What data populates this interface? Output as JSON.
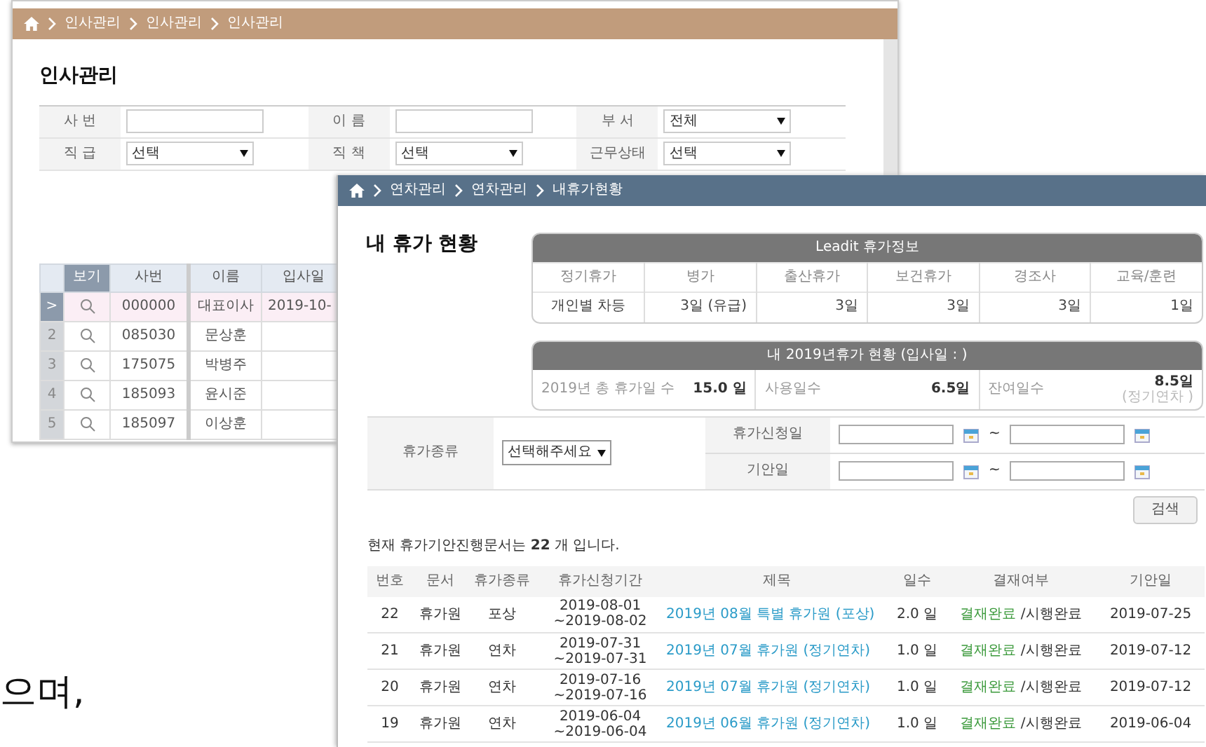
{
  "document_text": "으며,",
  "personnel_window": {
    "breadcrumb": [
      "인사관리",
      "인사관리",
      "인사관리"
    ],
    "title": "인사관리",
    "search_fields": [
      {
        "label": "사 번",
        "kind": "text"
      },
      {
        "label": "이 름",
        "kind": "text"
      },
      {
        "label": "부 서",
        "kind": "select",
        "value": "전체"
      },
      {
        "label": "직 급",
        "kind": "select",
        "value": "선택"
      },
      {
        "label": "직 책",
        "kind": "select",
        "value": "선택"
      },
      {
        "label": "근무상태",
        "kind": "select",
        "value": "선택"
      }
    ],
    "grid": {
      "columns": [
        "보기",
        "사번",
        "이름",
        "입사일"
      ],
      "rows": [
        {
          "marker": ">",
          "id": "000000",
          "name": "대표이사",
          "hire_date": "2019-10-",
          "selected": true
        },
        {
          "marker": "2",
          "id": "085030",
          "name": "문상훈",
          "hire_date": "",
          "selected": false
        },
        {
          "marker": "3",
          "id": "175075",
          "name": "박병주",
          "hire_date": "",
          "selected": false
        },
        {
          "marker": "4",
          "id": "185093",
          "name": "윤시준",
          "hire_date": "",
          "selected": false
        },
        {
          "marker": "5",
          "id": "185097",
          "name": "이상훈",
          "hire_date": "",
          "selected": false
        }
      ]
    }
  },
  "leave_window": {
    "breadcrumb": [
      "연차관리",
      "연차관리",
      "내휴가현황"
    ],
    "title": "내 휴가 현황",
    "leave_info": {
      "title": "Leadit 휴가정보",
      "columns": [
        "정기휴가",
        "병가",
        "출산휴가",
        "보건휴가",
        "경조사",
        "교육/훈련"
      ],
      "values": [
        "개인별 차등",
        "3일 (유급)",
        "3일",
        "3일",
        "3일",
        "1일"
      ]
    },
    "summary": {
      "title": "내 2019년휴가 현황 (입사일 : )",
      "items": [
        {
          "label": "2019년 총 휴가일 수",
          "value": "15.0 일"
        },
        {
          "label": "사용일수",
          "value": "6.5일"
        },
        {
          "label": "잔여일수",
          "value": "8.5일",
          "note": "(정기연차 )"
        }
      ]
    },
    "search": {
      "type_label": "휴가종류",
      "type_value": "선택해주세요",
      "date_rows": [
        {
          "label": "휴가신청일",
          "separator": "~"
        },
        {
          "label": "기안일",
          "separator": "~"
        }
      ],
      "button": "검색"
    },
    "count_text": "현재 휴가기안진행문서는 **22** 개 입니다.",
    "table": {
      "columns": [
        "번호",
        "문서",
        "휴가종류",
        "휴가신청기간",
        "제목",
        "일수",
        "결재여부",
        "기안일"
      ],
      "rows": [
        {
          "no": "22",
          "doc": "휴가원",
          "type": "포상",
          "period": "2019-08-01 ~2019-08-02",
          "title": "2019년 08월 특별 휴가원 (포상)",
          "days": "2.0 일",
          "approval": "결재완료",
          "execution": " /시행완료",
          "date": "2019-07-25"
        },
        {
          "no": "21",
          "doc": "휴가원",
          "type": "연차",
          "period": "2019-07-31 ~2019-07-31",
          "title": "2019년 07월 휴가원 (정기연차)",
          "days": "1.0 일",
          "approval": "결재완료",
          "execution": " /시행완료",
          "date": "2019-07-12"
        },
        {
          "no": "20",
          "doc": "휴가원",
          "type": "연차",
          "period": "2019-07-16 ~2019-07-16",
          "title": "2019년 07월 휴가원 (정기연차)",
          "days": "1.0 일",
          "approval": "결재완료",
          "execution": " /시행완료",
          "date": "2019-07-12"
        },
        {
          "no": "19",
          "doc": "휴가원",
          "type": "연차",
          "period": "2019-06-04 ~2019-06-04",
          "title": "2019년 06월 휴가원 (정기연차)",
          "days": "1.0 일",
          "approval": "결재완료",
          "execution": " /시행완료",
          "date": "2019-06-04"
        }
      ]
    }
  }
}
